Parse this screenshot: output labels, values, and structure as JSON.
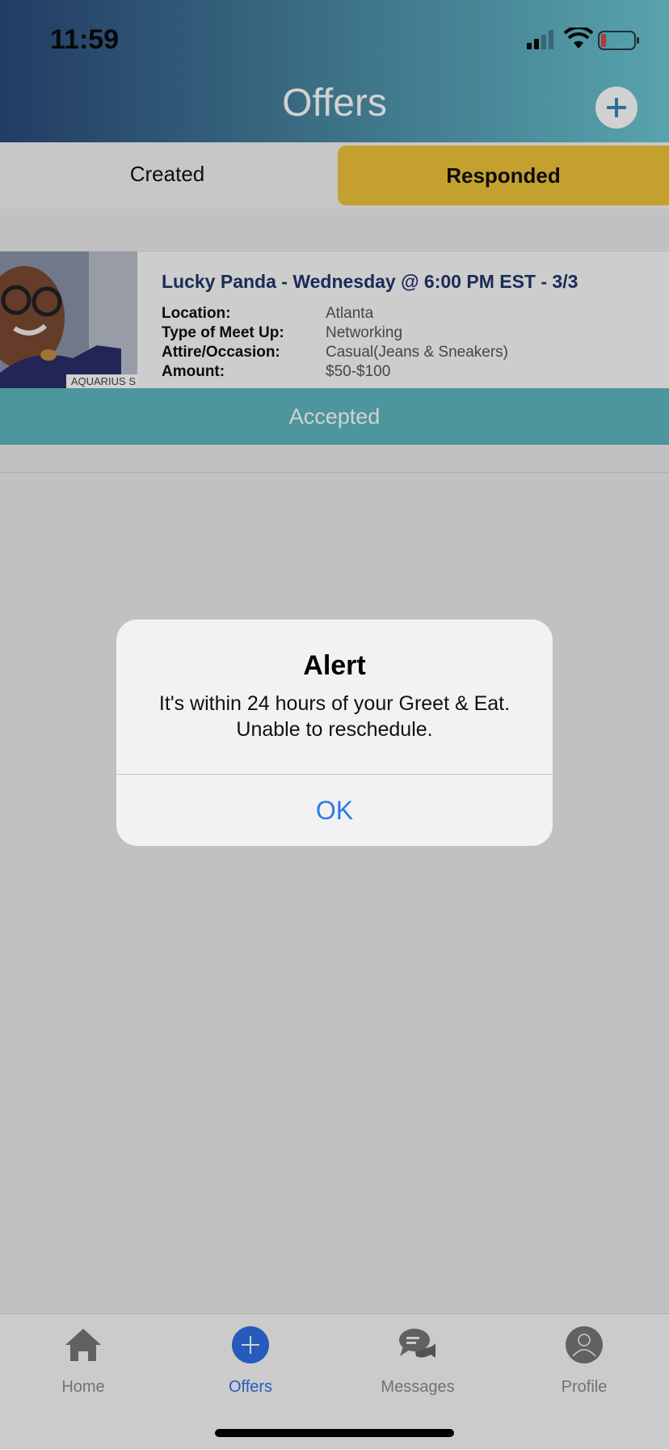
{
  "status_bar": {
    "time": "11:59"
  },
  "nav": {
    "title": "Offers",
    "add_icon": "plus-circle-icon"
  },
  "tabs": [
    {
      "label": "Created",
      "selected": false
    },
    {
      "label": "Responded",
      "selected": true
    }
  ],
  "offer": {
    "image_caption": "AQUARIUS S",
    "title": "Lucky Panda - Wednesday @ 6:00 PM EST - 3/3",
    "details": [
      {
        "label": "Location:",
        "value": "Atlanta"
      },
      {
        "label": "Type of Meet Up:",
        "value": "Networking"
      },
      {
        "label": "Attire/Occasion:",
        "value": "Casual(Jeans & Sneakers)"
      },
      {
        "label": "Amount:",
        "value": "$50-$100"
      }
    ],
    "status": "Accepted"
  },
  "alert": {
    "title": "Alert",
    "message": "It's within 24 hours of your Greet & Eat. Unable to reschedule.",
    "ok_label": "OK"
  },
  "tab_bar": [
    {
      "label": "Home",
      "icon": "home-icon"
    },
    {
      "label": "Offers",
      "icon": "plus-circle-icon",
      "active": true
    },
    {
      "label": "Messages",
      "icon": "chat-bubbles-icon"
    },
    {
      "label": "Profile",
      "icon": "person-icon"
    }
  ],
  "colors": {
    "accent": "#f0c53a",
    "accepted": "#5fb8c0",
    "active_tab": "#2f6fe4",
    "alert_button": "#2f7ae5"
  }
}
